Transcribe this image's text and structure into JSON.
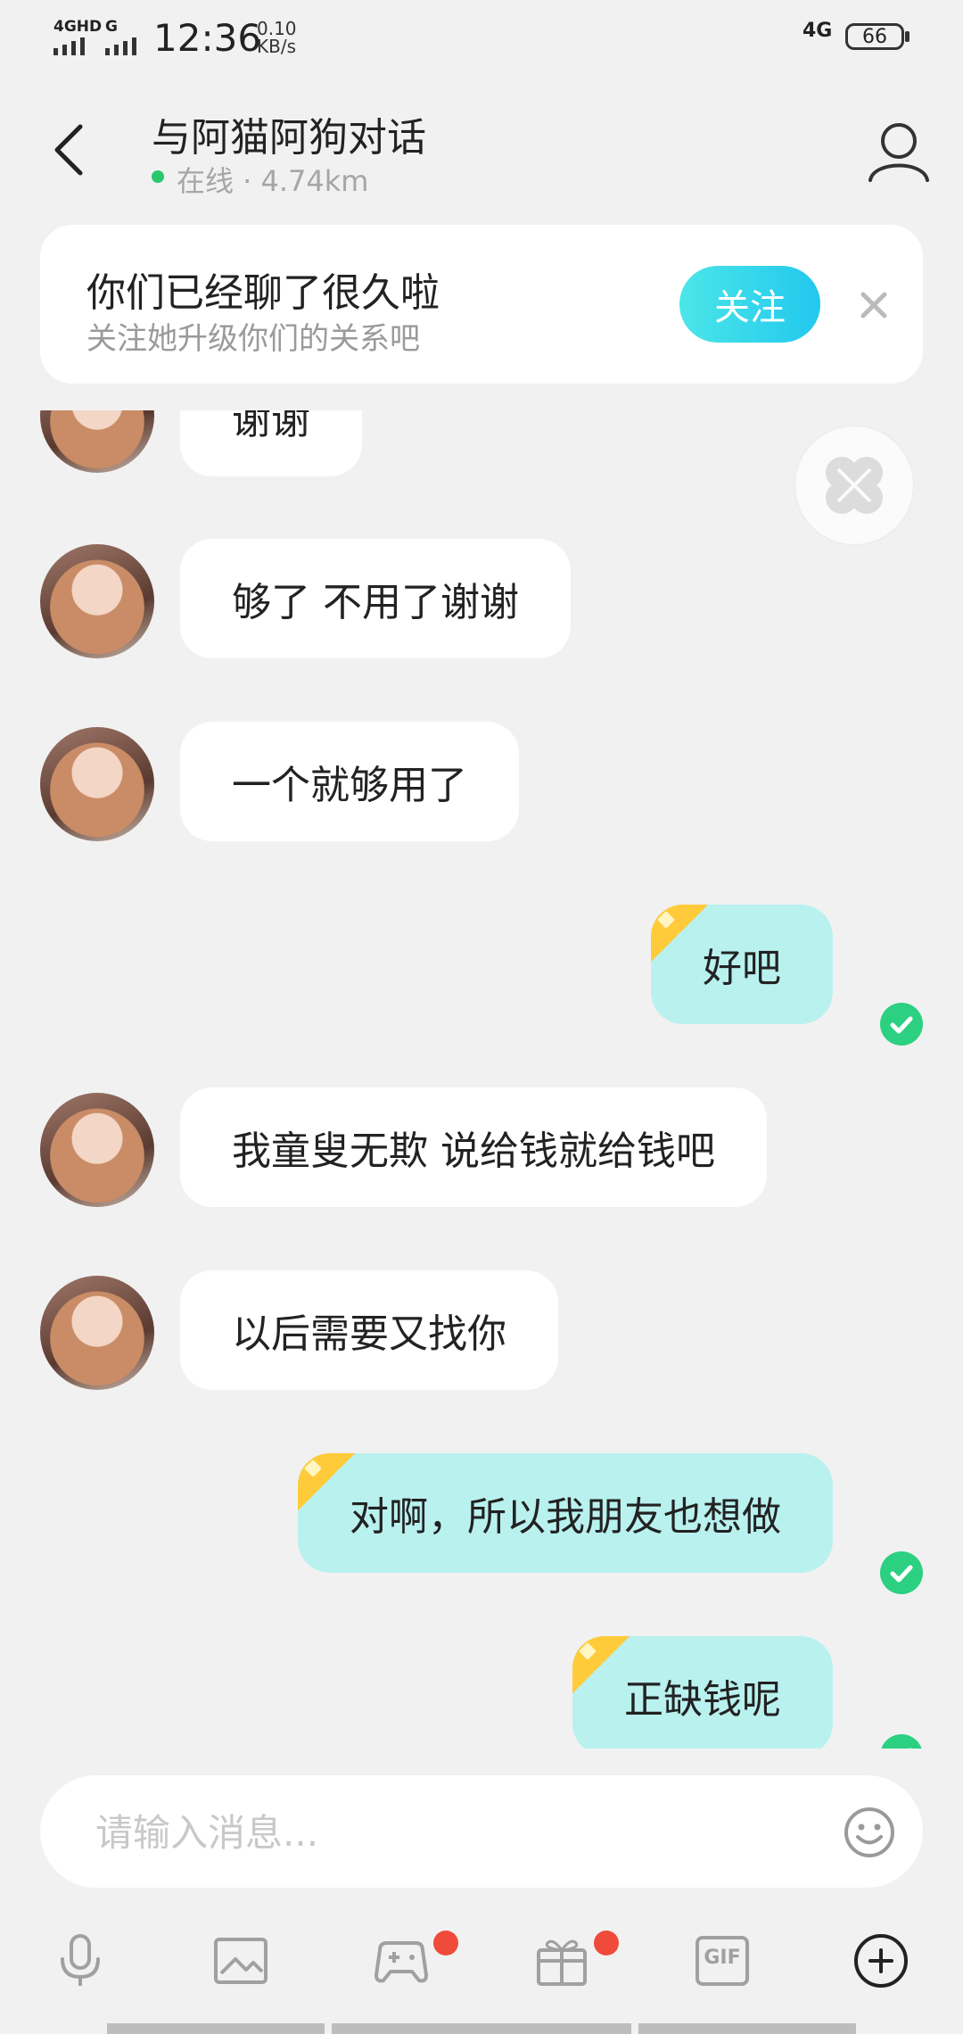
{
  "status_bar": {
    "network1": "4GHD",
    "network2": "G",
    "time": "12:36",
    "speed_value": "0.10",
    "speed_unit": "KB/s",
    "network_right": "4G",
    "battery": "66"
  },
  "header": {
    "title": "与阿猫阿狗对话",
    "status": "在线 · 4.74km"
  },
  "follow_card": {
    "title": "你们已经聊了很久啦",
    "subtitle": "关注她升级你们的关系吧",
    "follow_label": "关注"
  },
  "messages": [
    {
      "from": "them",
      "text": "谢谢"
    },
    {
      "from": "them",
      "text": "够了 不用了谢谢"
    },
    {
      "from": "them",
      "text": "一个就够用了"
    },
    {
      "from": "me",
      "text": "好吧",
      "read": true
    },
    {
      "from": "them",
      "text": "我童叟无欺 说给钱就给钱吧"
    },
    {
      "from": "them",
      "text": "以后需要又找你"
    },
    {
      "from": "me",
      "text": "对啊，所以我朋友也想做",
      "read": true
    },
    {
      "from": "me",
      "text": "正缺钱呢",
      "read": true
    }
  ],
  "composer": {
    "placeholder": "请输入消息..."
  },
  "toolbar": {
    "icons": [
      "microphone-icon",
      "image-icon",
      "game-icon",
      "gift-icon",
      "gif-icon",
      "plus-circle-icon"
    ],
    "gif_label": "GIF",
    "badges": {
      "game": true,
      "gift": true
    }
  },
  "colors": {
    "background": "#f1f1f1",
    "my_bubble": "#b9f1ef",
    "their_bubble": "#ffffff",
    "accent": "#22c8ee",
    "online": "#2ac86c",
    "read_check": "#2bd080",
    "badge": "#f04a3a"
  }
}
